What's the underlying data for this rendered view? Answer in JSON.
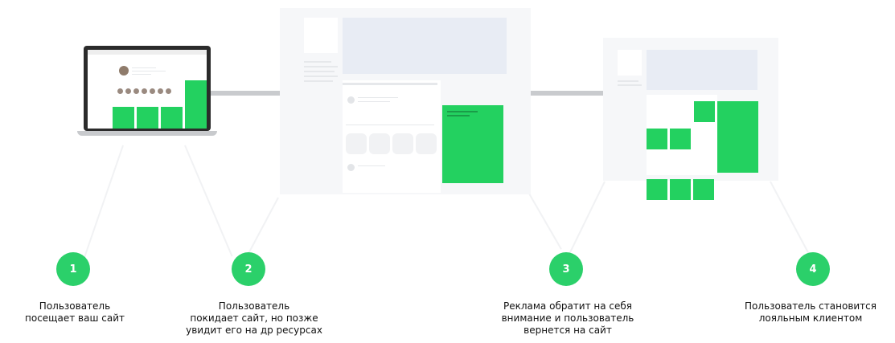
{
  "steps": [
    {
      "number": "1",
      "lines": [
        "Пользователь",
        "посещает ваш сайт"
      ]
    },
    {
      "number": "2",
      "lines": [
        "Пользователь",
        "покидает сайт, но позже",
        "увидит его на др ресурсах"
      ]
    },
    {
      "number": "3",
      "lines": [
        "Реклама обратит на себя",
        "внимание и пользователь",
        "вернется на сайт"
      ]
    },
    {
      "number": "4",
      "lines": [
        "Пользователь становится",
        "лояльным клиентом"
      ]
    }
  ],
  "colors": {
    "accent": "#23d160",
    "connector": "#c9cbce",
    "panel": "#f6f7f9"
  }
}
